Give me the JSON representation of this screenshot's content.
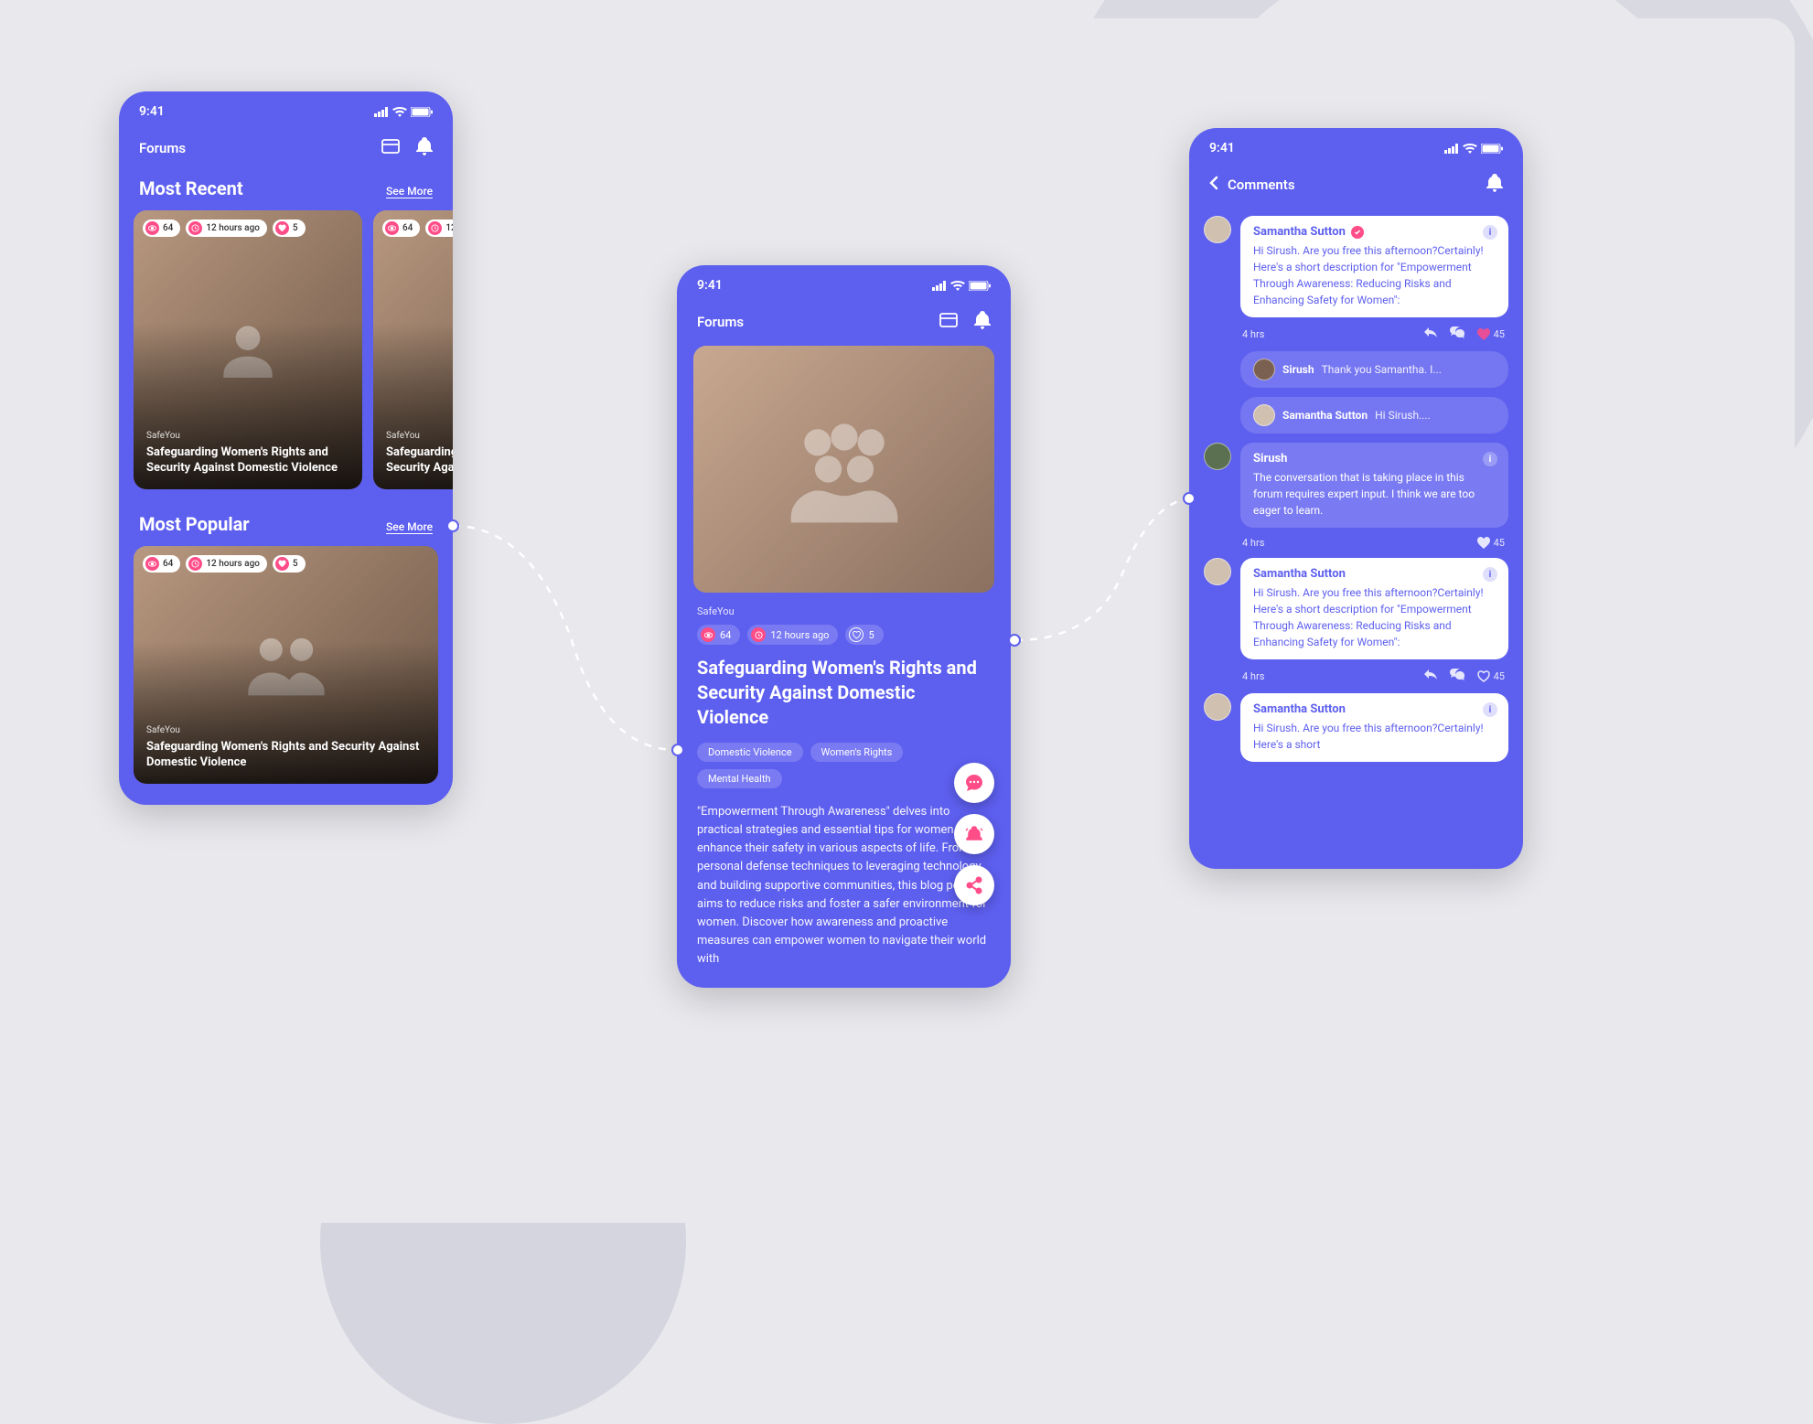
{
  "status_time": "9:41",
  "screen1": {
    "header": "Forums",
    "sec1_title": "Most Recent",
    "see_more": "See More",
    "sec2_title": "Most Popular",
    "card_source": "SafeYou",
    "card_title": "Safeguarding Women's Rights and Security Against Domestic Violence",
    "card_title_pop": "Safeguarding Women's Rights and Security Against Domestic Violence",
    "views": "64",
    "time": "12 hours ago",
    "likes": "5"
  },
  "screen2": {
    "header": "Forums",
    "source": "SafeYou",
    "views": "64",
    "time": "12 hours ago",
    "likes": "5",
    "title": "Safeguarding Women's Rights and Security Against Domestic Violence",
    "tag1": "Domestic Violence",
    "tag2": "Women's Rights",
    "tag3": "Mental Health",
    "body": "\"Empowerment Through Awareness\" delves into practical strategies and essential tips for women to enhance their safety in various aspects of life. From personal defense techniques to leveraging technology and building supportive communities, this blog post aims to reduce risks and foster a safer environment for women. Discover how awareness and proactive measures can empower women to navigate their world with"
  },
  "screen3": {
    "header": "Comments",
    "c1_name": "Samantha Sutton",
    "c1_text": "Hi Sirush. Are you free this afternoon?Certainly! Here's a short description for \"Empowerment Through Awareness: Reducing Risks and Enhancing Safety for Women\":",
    "time_label": "4  hrs",
    "like_count": "45",
    "r1_name": "Sirush",
    "r1_text": "Thank you Samantha. I...",
    "r2_name": "Samantha Sutton",
    "r2_text": "Hi Sirush....",
    "c2_name": "Sirush",
    "c2_text": "The conversation that is taking place in this forum requires expert input. I think we are too eager to learn.",
    "c3_name": "Samantha Sutton",
    "c3_text": "Hi Sirush. Are you free this afternoon?Certainly! Here's a short description for \"Empowerment Through Awareness: Reducing Risks and Enhancing Safety for Women\":",
    "c4_name": "Samantha Sutton",
    "c4_text": "Hi Sirush. Are you free this afternoon?Certainly! Here's a short"
  }
}
